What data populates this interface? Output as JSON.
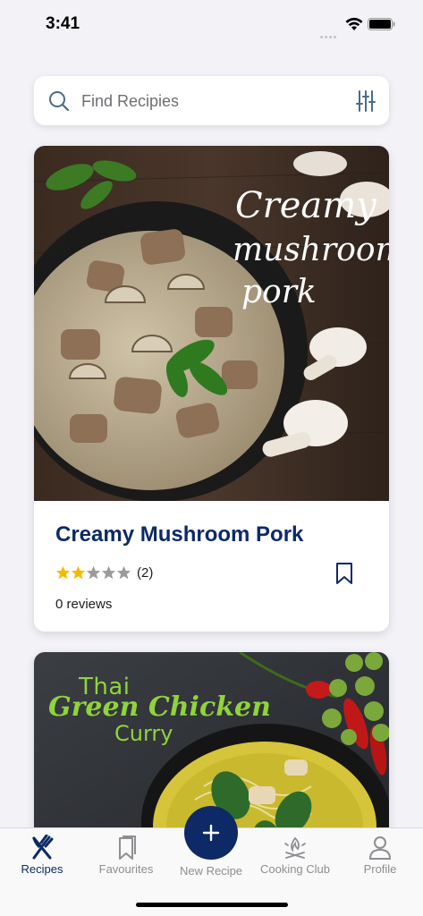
{
  "status_bar": {
    "time": "3:41"
  },
  "search": {
    "placeholder": "Find Recipies",
    "icon": "search-icon",
    "filter_icon": "sliders-icon"
  },
  "recipes": [
    {
      "title": "Creamy Mushroom Pork",
      "image_text": [
        "Creamy",
        "mushroom",
        "pork"
      ],
      "rating": 2,
      "rating_max": 5,
      "rating_count": "(2)",
      "reviews": "0 reviews",
      "bookmarked": false
    },
    {
      "image_text": [
        "Thai",
        "Green Chicken",
        "Curry"
      ]
    }
  ],
  "tab_bar": {
    "items": [
      {
        "label": "Recipes",
        "icon": "fork-knife-icon",
        "active": true
      },
      {
        "label": "Favourites",
        "icon": "bookmarks-icon",
        "active": false
      },
      {
        "label": "New Recipe",
        "icon": "plus-icon",
        "active": false
      },
      {
        "label": "Cooking Club",
        "icon": "campfire-icon",
        "active": false
      },
      {
        "label": "Profile",
        "icon": "person-icon",
        "active": false
      }
    ]
  },
  "colors": {
    "brand_navy": "#0d2a66",
    "star_filled": "#f5b800",
    "star_empty": "#9b9b9b",
    "thai_title": "#8fd43b",
    "background": "#f2f2f7"
  }
}
